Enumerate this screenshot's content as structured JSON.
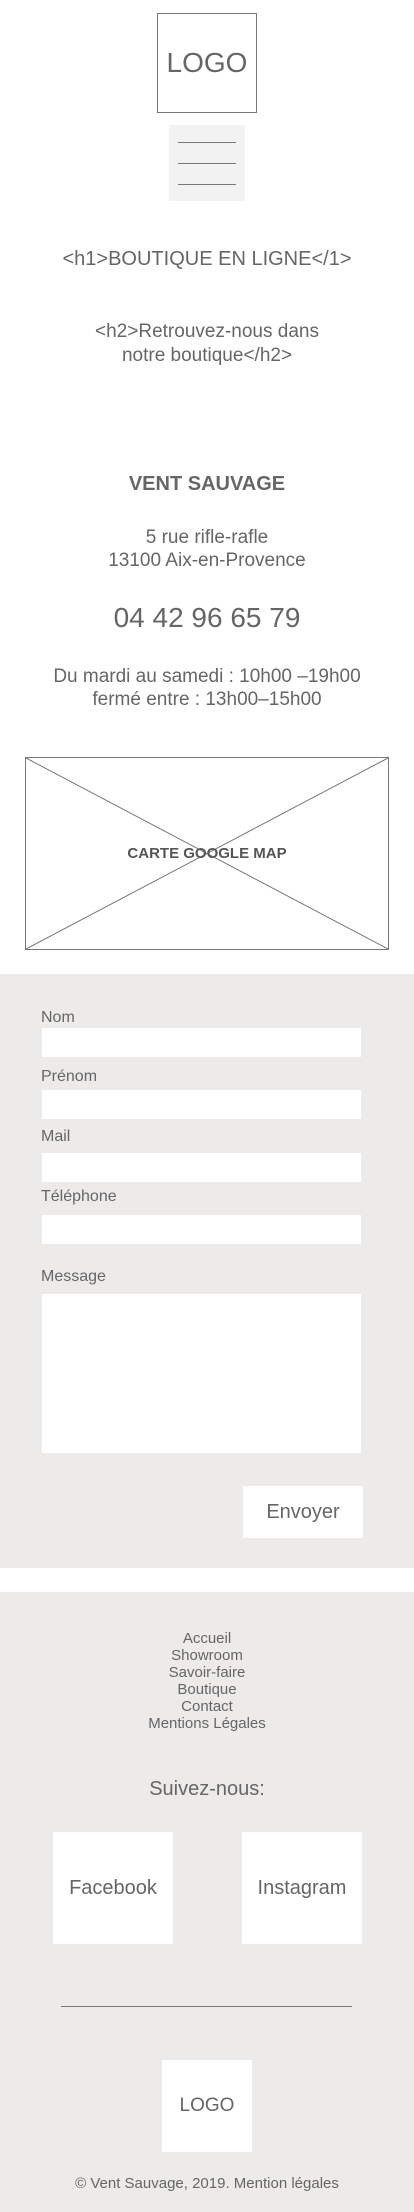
{
  "header": {
    "logo": "LOGO",
    "menu_icon": "hamburger-menu-icon"
  },
  "hero": {
    "h1": "<h1>BOUTIQUE EN LIGNE</1>",
    "h2_line1": "<h2>Retrouvez-nous dans",
    "h2_line2": "notre boutique</h2>"
  },
  "shop": {
    "name": "VENT SAUVAGE",
    "street": "5 rue rifle-rafle",
    "city": "13100 Aix-en-Provence",
    "phone": "04 42 96 65 79",
    "hours_line1": "Du mardi au samedi : 10h00 –19h00",
    "hours_line2": "fermé entre  : 13h00–15h00"
  },
  "map": {
    "label": "CARTE GOOGLE MAP"
  },
  "form": {
    "nom_label": "Nom",
    "prenom_label": "Prénom",
    "mail_label": "Mail",
    "telephone_label": "Téléphone",
    "message_label": "Message",
    "submit_label": "Envoyer"
  },
  "footer": {
    "nav": [
      "Accueil",
      "Showroom",
      "Savoir-faire",
      "Boutique",
      "Contact",
      "Mentions Légales"
    ],
    "follow": "Suivez-nous:",
    "facebook": "Facebook",
    "instagram": "Instagram",
    "logo": "LOGO",
    "copyright": "© Vent Sauvage, 2019. Mention légales"
  },
  "colors": {
    "background": "#ffffff",
    "section_bg": "#ecebe9",
    "text": "#666666",
    "border": "#777777"
  }
}
